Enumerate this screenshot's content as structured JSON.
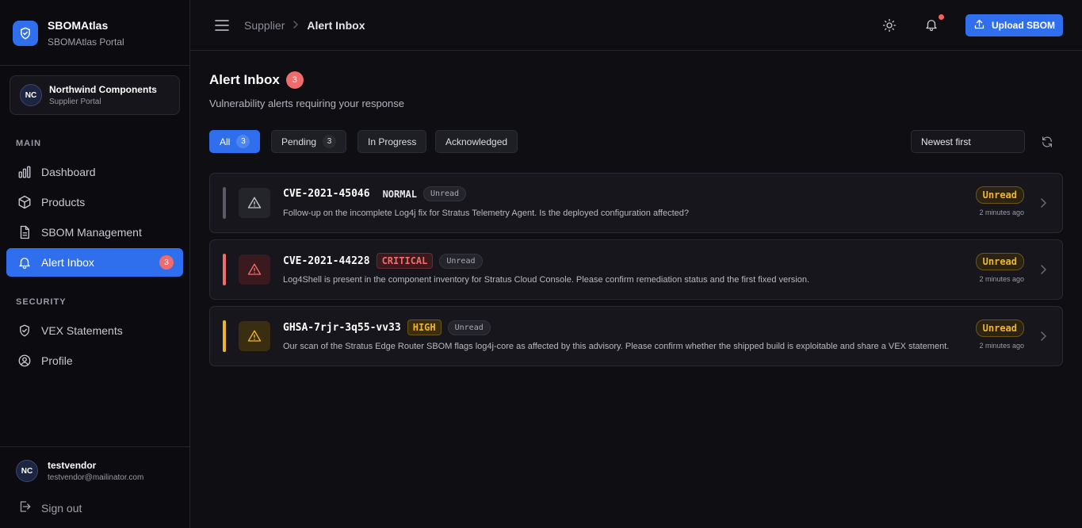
{
  "brand": {
    "name": "SBOMAtlas",
    "subtitle": "SBOMAtlas Portal",
    "icon": "shield-check-icon"
  },
  "org": {
    "initials": "NC",
    "name": "Northwind Components",
    "subtitle": "Supplier Portal"
  },
  "sidebar": {
    "sections": [
      {
        "label": "MAIN",
        "items": [
          {
            "label": "Dashboard",
            "icon": "bar-chart-icon"
          },
          {
            "label": "Products",
            "icon": "box-icon"
          },
          {
            "label": "SBOM Management",
            "icon": "file-icon"
          },
          {
            "label": "Alert Inbox",
            "icon": "bell-icon",
            "active": true,
            "badge": "3"
          }
        ]
      },
      {
        "label": "SECURITY",
        "items": [
          {
            "label": "VEX Statements",
            "icon": "shield-icon"
          },
          {
            "label": "Profile",
            "icon": "user-icon"
          }
        ]
      }
    ]
  },
  "user": {
    "initials": "NC",
    "name": "testvendor",
    "email": "testvendor@mailinator.com"
  },
  "signout": {
    "label": "Sign out"
  },
  "topbar": {
    "breadcrumb": [
      "Supplier",
      "Alert Inbox"
    ],
    "upload_label": "Upload SBOM"
  },
  "page": {
    "title": "Alert Inbox",
    "count": "3",
    "subtitle": "Vulnerability alerts requiring your response"
  },
  "filters": [
    {
      "label": "All",
      "count": "3",
      "active": true
    },
    {
      "label": "Pending",
      "count": "3"
    },
    {
      "label": "In Progress"
    },
    {
      "label": "Acknowledged"
    }
  ],
  "sort": {
    "value": "Newest first"
  },
  "colors": {
    "accent": "#2f6fed",
    "critical": "#f36b6b",
    "high": "#f0b429",
    "normal": "#6b6b78"
  },
  "alerts": [
    {
      "id": "CVE-2021-45046",
      "severity": "NORMAL",
      "read_state": "Unread",
      "description": "Follow-up on the incomplete Log4j fix for Stratus Telemetry Agent. Is the deployed configuration affected?",
      "status": "Unread",
      "time": "2 minutes ago"
    },
    {
      "id": "CVE-2021-44228",
      "severity": "CRITICAL",
      "read_state": "Unread",
      "description": "Log4Shell is present in the component inventory for Stratus Cloud Console. Please confirm remediation status and the first fixed version.",
      "status": "Unread",
      "time": "2 minutes ago"
    },
    {
      "id": "GHSA-7rjr-3q55-vv33",
      "severity": "HIGH",
      "read_state": "Unread",
      "description": "Our scan of the Stratus Edge Router SBOM flags log4j-core as affected by this advisory. Please confirm whether the shipped build is exploitable and share a VEX statement.",
      "status": "Unread",
      "time": "2 minutes ago"
    }
  ]
}
